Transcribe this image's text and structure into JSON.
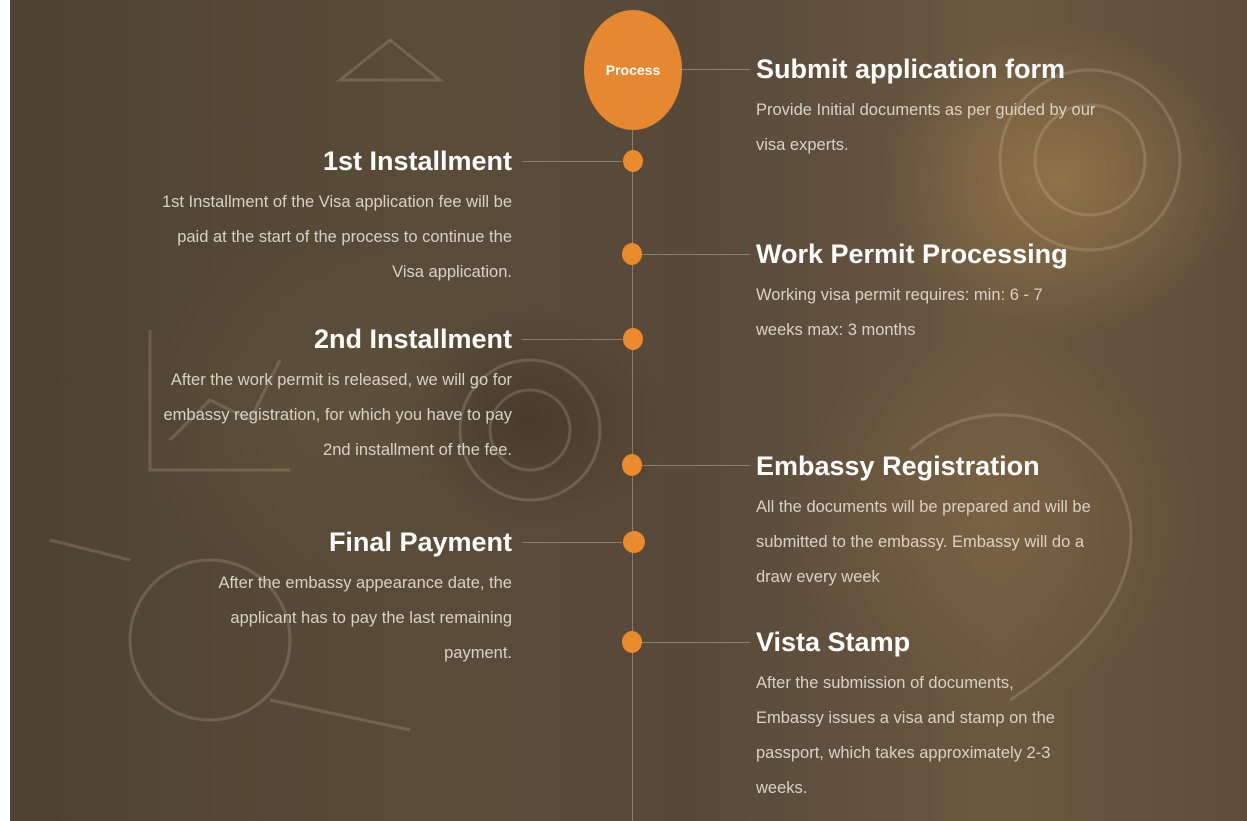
{
  "badge": {
    "label": "Process"
  },
  "left_steps": [
    {
      "title": "1st Installment",
      "text": "1st Installment of the Visa application fee will be paid at the start of the process to continue the Visa application."
    },
    {
      "title": "2nd Installment",
      "text": "After the work permit is released, we will go for embassy registration, for which you have to pay 2nd installment of the fee."
    },
    {
      "title": "Final Payment",
      "text": "After the embassy appearance date, the applicant has to pay the last remaining payment."
    }
  ],
  "right_steps": [
    {
      "title": "Submit application form",
      "text": "Provide Initial documents as per guided by our visa experts."
    },
    {
      "title": "Work Permit Processing",
      "text": "Working visa permit requires: min: 6 - 7 weeks max: 3 months"
    },
    {
      "title": "Embassy Registration",
      "text": "All the documents will be prepared and will be submitted to the embassy. Embassy will do a draw every week"
    },
    {
      "title": "Vista Stamp",
      "text": "After the submission of documents, Embassy issues a visa and stamp on the passport, which takes approximately 2-3 weeks."
    }
  ],
  "colors": {
    "accent": "#ec8a2e",
    "background": "#57493a",
    "title": "#ffffff",
    "body_text": "#d8d2c6"
  }
}
